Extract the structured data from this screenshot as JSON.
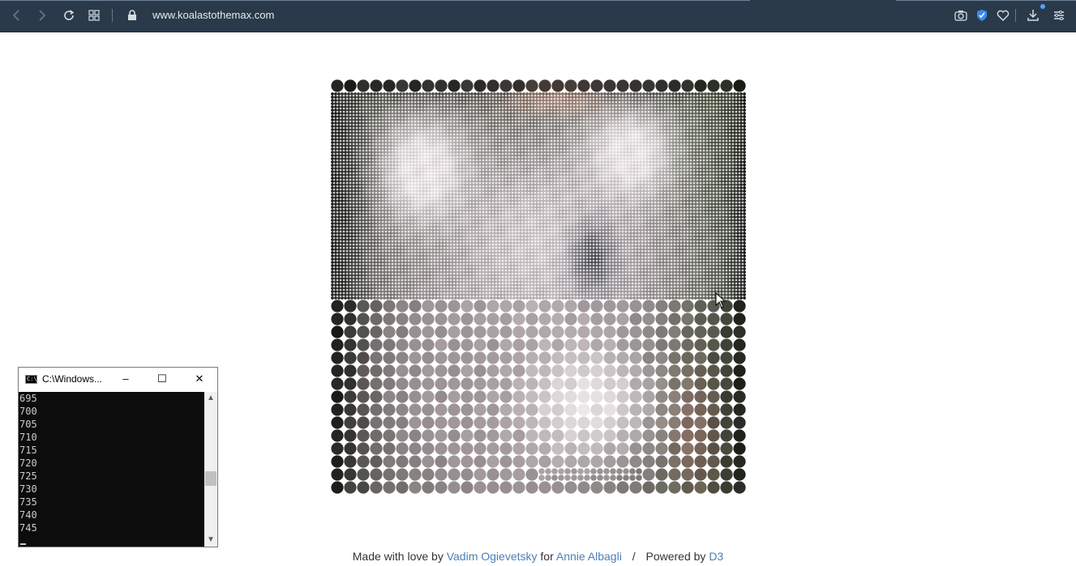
{
  "browser": {
    "url": "www.koalastothemax.com",
    "icons": {
      "back": "arrow-left-icon",
      "forward": "arrow-right-icon",
      "reload": "reload-icon",
      "tabs": "grid-icon",
      "lock": "lock-icon",
      "screenshot": "camera-icon",
      "shield": "shield-icon",
      "favorite": "heart-icon",
      "download": "download-icon",
      "menu": "menu-icon"
    }
  },
  "page": {
    "footer": {
      "made_with_love": "Made with love by",
      "author": "Vadim Ogievetsky",
      "for_text": "for",
      "recipient": "Annie Albagli",
      "separator": "/",
      "powered_by": "Powered by",
      "library": "D3"
    }
  },
  "console": {
    "title": "C:\\Windows...",
    "lines": [
      "695",
      "700",
      "705",
      "710",
      "715",
      "720",
      "725",
      "730",
      "735",
      "740",
      "745"
    ],
    "minimize": "–",
    "maximize": "☐",
    "close": "✕"
  }
}
